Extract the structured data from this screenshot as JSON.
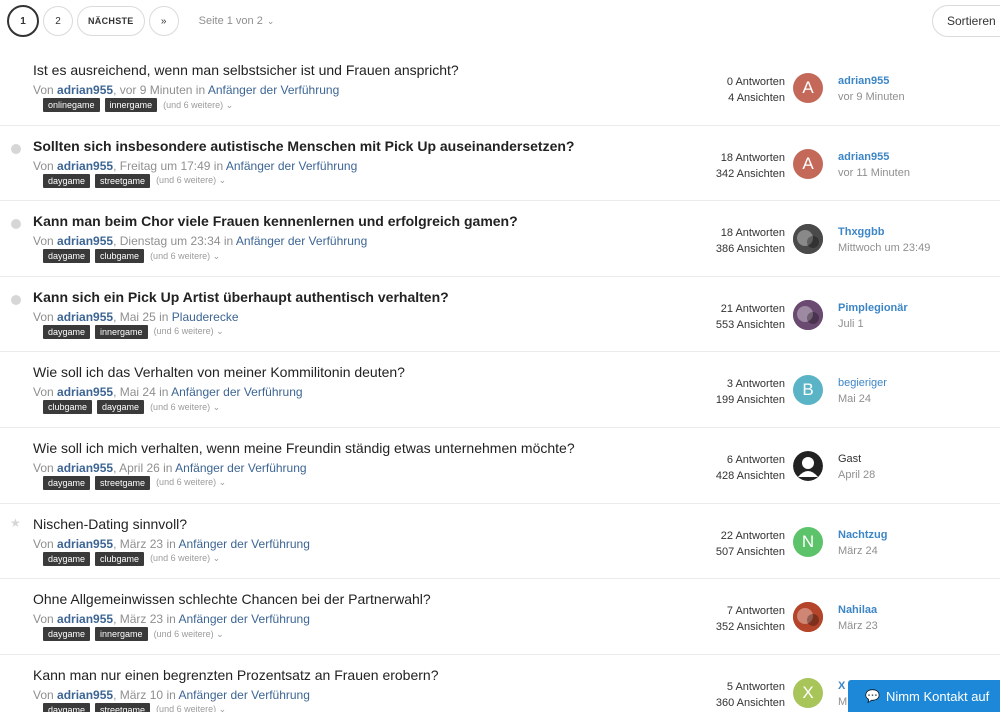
{
  "pagination": {
    "pages": [
      "1",
      "2"
    ],
    "next_label": "NÄCHSTE",
    "last_label": "»",
    "page_info": "Seite 1 von 2",
    "chevron": "⌄"
  },
  "sort_label": "Sortieren",
  "contact_label": "Nimm Kontakt auf",
  "colors": {
    "link": "#3d6594",
    "user_link": "#3d86c6",
    "tag_bg": "#3a3a3a",
    "contact": "#1e88d8"
  },
  "topics": [
    {
      "title": "Ist es ausreichend, wenn man selbstsicher ist und Frauen anspricht?",
      "bold": false,
      "marker": "none",
      "by": "Von",
      "author": "adrian955",
      "date": ", vor 9 Minuten in ",
      "forum": "Anfänger der Verführung",
      "tags": [
        "onlinegame",
        "innergame"
      ],
      "more": "(und 6 weitere) ⌄",
      "replies": "0 Antworten",
      "views": "4 Ansichten",
      "avatar": {
        "letter": "A",
        "bg": "#c4695a",
        "icon": "letter-avatar-icon"
      },
      "last_user": "adrian955",
      "last_user_style": "bold",
      "last_time": "vor 9 Minuten"
    },
    {
      "title": "Sollten sich insbesondere autistische Menschen mit Pick Up auseinandersetzen?",
      "bold": true,
      "marker": "dot",
      "by": "Von",
      "author": "adrian955",
      "date": ", Freitag um 17:49 in ",
      "forum": "Anfänger der Verführung",
      "tags": [
        "daygame",
        "streetgame"
      ],
      "more": "(und 6 weitere) ⌄",
      "replies": "18 Antworten",
      "views": "342 Ansichten",
      "avatar": {
        "letter": "A",
        "bg": "#c4695a",
        "icon": "letter-avatar-icon"
      },
      "last_user": "adrian955",
      "last_user_style": "bold",
      "last_time": "vor 11 Minuten"
    },
    {
      "title": "Kann man beim Chor viele Frauen kennenlernen und erfolgreich gamen?",
      "bold": true,
      "marker": "dot",
      "by": "Von",
      "author": "adrian955",
      "date": ", Dienstag um 23:34 in ",
      "forum": "Anfänger der Verführung",
      "tags": [
        "daygame",
        "clubgame"
      ],
      "more": "(und 6 weitere) ⌄",
      "replies": "18 Antworten",
      "views": "386 Ansichten",
      "avatar": {
        "letter": "",
        "bg": "#4a4a4a",
        "icon": "photo-avatar-icon"
      },
      "last_user": "Thxggbb",
      "last_user_style": "bold",
      "last_time": "Mittwoch um 23:49"
    },
    {
      "title": "Kann sich ein Pick Up Artist überhaupt authentisch verhalten?",
      "bold": true,
      "marker": "dot",
      "by": "Von",
      "author": "adrian955",
      "date": ", Mai 25 in ",
      "forum": "Plauderecke",
      "tags": [
        "daygame",
        "innergame"
      ],
      "more": "(und 6 weitere) ⌄",
      "replies": "21 Antworten",
      "views": "553 Ansichten",
      "avatar": {
        "letter": "",
        "bg": "#6b4a72",
        "icon": "photo-avatar-icon"
      },
      "last_user": "Pimplegionär",
      "last_user_style": "bold",
      "last_time": "Juli 1"
    },
    {
      "title": "Wie soll ich das Verhalten von meiner Kommilitonin deuten?",
      "bold": false,
      "marker": "none",
      "by": "Von",
      "author": "adrian955",
      "date": ", Mai 24 in ",
      "forum": "Anfänger der Verführung",
      "tags": [
        "clubgame",
        "daygame"
      ],
      "more": "(und 6 weitere) ⌄",
      "replies": "3 Antworten",
      "views": "199 Ansichten",
      "avatar": {
        "letter": "B",
        "bg": "#5bb4c6",
        "icon": "letter-avatar-icon"
      },
      "last_user": "begieriger",
      "last_user_style": "plain",
      "last_time": "Mai 24"
    },
    {
      "title": "Wie soll ich mich verhalten, wenn meine Freundin ständig etwas unternehmen möchte?",
      "bold": false,
      "marker": "none",
      "by": "Von",
      "author": "adrian955",
      "date": ", April 26 in ",
      "forum": "Anfänger der Verführung",
      "tags": [
        "daygame",
        "streetgame"
      ],
      "more": "(und 6 weitere) ⌄",
      "replies": "6 Antworten",
      "views": "428 Ansichten",
      "avatar": {
        "letter": "",
        "bg": "#ffffff",
        "icon": "guest-avatar-icon"
      },
      "last_user": "Gast",
      "last_user_style": "guest",
      "last_time": "April 28"
    },
    {
      "title": "Nischen-Dating sinnvoll?",
      "bold": false,
      "marker": "star",
      "by": "Von",
      "author": "adrian955",
      "date": ", März 23 in ",
      "forum": "Anfänger der Verführung",
      "tags": [
        "daygame",
        "clubgame"
      ],
      "more": "(und 6 weitere) ⌄",
      "replies": "22 Antworten",
      "views": "507 Ansichten",
      "avatar": {
        "letter": "N",
        "bg": "#5cc36a",
        "icon": "letter-avatar-icon"
      },
      "last_user": "Nachtzug",
      "last_user_style": "bold",
      "last_time": "März 24"
    },
    {
      "title": "Ohne Allgemeinwissen schlechte Chancen bei der Partnerwahl?",
      "bold": false,
      "marker": "none",
      "by": "Von",
      "author": "adrian955",
      "date": ", März 23 in ",
      "forum": "Anfänger der Verführung",
      "tags": [
        "daygame",
        "innergame"
      ],
      "more": "(und 6 weitere) ⌄",
      "replies": "7 Antworten",
      "views": "352 Ansichten",
      "avatar": {
        "letter": "",
        "bg": "#b5452a",
        "icon": "photo-avatar-icon"
      },
      "last_user": "Nahilaa",
      "last_user_style": "bold",
      "last_time": "März 23"
    },
    {
      "title": "Kann man nur einen begrenzten Prozentsatz an Frauen erobern?",
      "bold": false,
      "marker": "none",
      "by": "Von",
      "author": "adrian955",
      "date": ", März 10 in ",
      "forum": "Anfänger der Verführung",
      "tags": [
        "daygame",
        "streetgame"
      ],
      "more": "(und 6 weitere) ⌄",
      "replies": "5 Antworten",
      "views": "360 Ansichten",
      "avatar": {
        "letter": "X",
        "bg": "#a8c55a",
        "icon": "letter-avatar-icon"
      },
      "last_user": "X",
      "last_user_style": "bold",
      "last_time": "M"
    }
  ]
}
